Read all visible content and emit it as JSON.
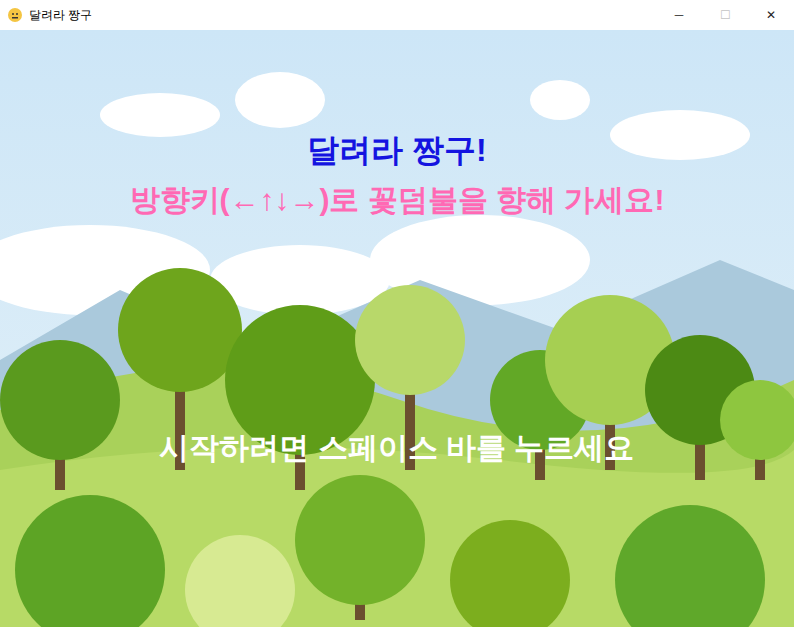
{
  "window": {
    "title": "달려라 짱구",
    "controls": [
      {
        "label": "─",
        "disabled": false
      },
      {
        "label": "☐",
        "disabled": true
      },
      {
        "label": "✕",
        "disabled": false
      }
    ]
  },
  "screen": {
    "title": "달려라 짱구!",
    "instruction": "방향키(←↑↓→)로 꽃덤불을 향해 가세요!",
    "prompt": "시작하려면 스페이스 바를 누르세요"
  }
}
